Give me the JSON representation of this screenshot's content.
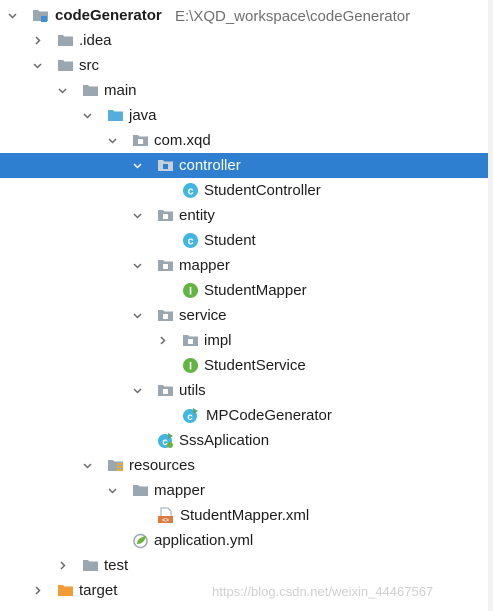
{
  "project": {
    "name": "codeGenerator",
    "path": "E:\\XQD_workspace\\codeGenerator"
  },
  "tree": {
    "idea": ".idea",
    "src": "src",
    "main": "main",
    "java": "java",
    "package": "com.xqd",
    "controller": "controller",
    "student_controller": "StudentController",
    "entity": "entity",
    "student": "Student",
    "mapper": "mapper",
    "student_mapper": "StudentMapper",
    "service": "service",
    "impl": "impl",
    "student_service": "StudentService",
    "utils": "utils",
    "mp_code_generator": "MPCodeGenerator",
    "sss_aplication": "SssAplication",
    "resources": "resources",
    "res_mapper": "mapper",
    "student_mapper_xml": "StudentMapper.xml",
    "application_yml": "application.yml",
    "test": "test",
    "target": "target"
  },
  "watermark": "https://blog.csdn.net/weixin_44467567",
  "colors": {
    "selection": "#2f7fd0",
    "folder": "#9aa7b0",
    "source_folder": "#54aeda",
    "resource_folder": "#9aa7b0",
    "target_folder": "#f19b3a",
    "class_icon": "#40b6e0",
    "interface_icon": "#62b543",
    "spring_leaf": "#6db33f"
  }
}
